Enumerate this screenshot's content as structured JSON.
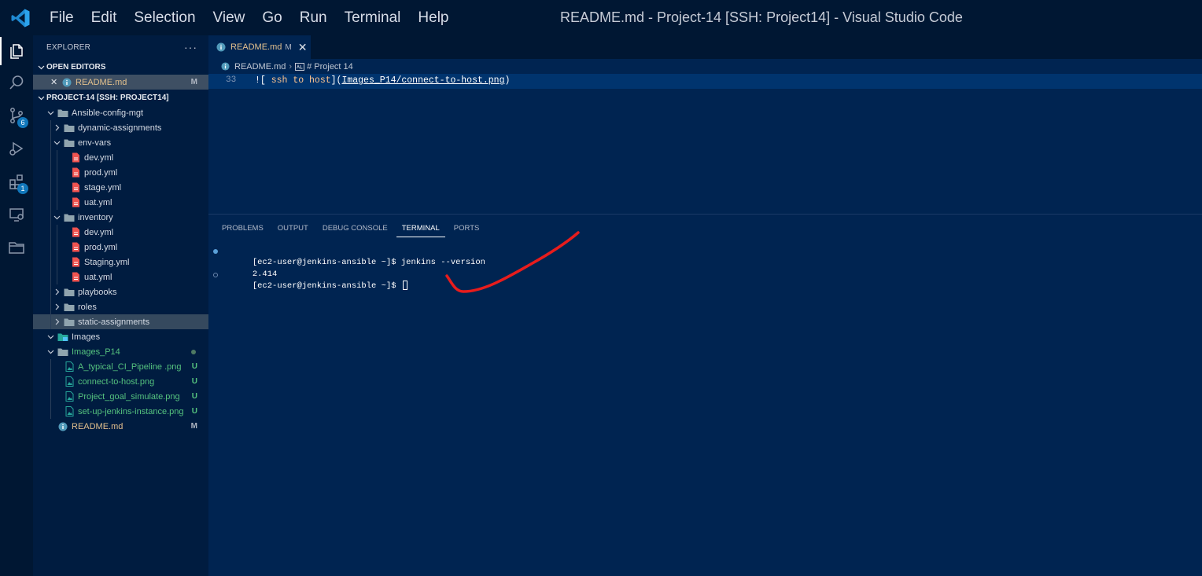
{
  "titlebar": {
    "menu": [
      "File",
      "Edit",
      "Selection",
      "View",
      "Go",
      "Run",
      "Terminal",
      "Help"
    ],
    "window_title": "README.md - Project-14 [SSH: Project14] - Visual Studio Code"
  },
  "activitybar": {
    "items": [
      {
        "icon": "explorer-icon",
        "active": true
      },
      {
        "icon": "search-icon"
      },
      {
        "icon": "source-control-icon",
        "badge": "6"
      },
      {
        "icon": "run-debug-icon"
      },
      {
        "icon": "extensions-icon",
        "badge": "1"
      },
      {
        "icon": "remote-explorer-icon"
      },
      {
        "icon": "folder-icon"
      }
    ]
  },
  "sidebar": {
    "title": "EXPLORER",
    "more": "···",
    "open_editors": {
      "header": "OPEN EDITORS",
      "file": "README.md",
      "status": "M"
    },
    "project": {
      "header": "PROJECT-14 [SSH: PROJECT14]",
      "tree": [
        {
          "label": "Ansible-config-mgt",
          "type": "folder",
          "open": true,
          "depth": 0
        },
        {
          "label": "dynamic-assignments",
          "type": "folder",
          "open": false,
          "depth": 1
        },
        {
          "label": "env-vars",
          "type": "folder",
          "open": true,
          "depth": 1
        },
        {
          "label": "dev.yml",
          "type": "yml",
          "depth": 2
        },
        {
          "label": "prod.yml",
          "type": "yml",
          "depth": 2
        },
        {
          "label": "stage.yml",
          "type": "yml",
          "depth": 2
        },
        {
          "label": "uat.yml",
          "type": "yml",
          "depth": 2
        },
        {
          "label": "inventory",
          "type": "folder",
          "open": true,
          "depth": 1
        },
        {
          "label": "dev.yml",
          "type": "yml",
          "depth": 2
        },
        {
          "label": "prod.yml",
          "type": "yml",
          "depth": 2
        },
        {
          "label": "Staging.yml",
          "type": "yml",
          "depth": 2
        },
        {
          "label": "uat.yml",
          "type": "yml",
          "depth": 2
        },
        {
          "label": "playbooks",
          "type": "folder",
          "open": false,
          "depth": 1
        },
        {
          "label": "roles",
          "type": "folder",
          "open": false,
          "depth": 1
        },
        {
          "label": "static-assignments",
          "type": "folder",
          "open": false,
          "depth": 1,
          "selected": true
        },
        {
          "label": "Images",
          "type": "image-folder",
          "open": true,
          "depth": 0
        },
        {
          "label": "Images_P14",
          "type": "folder",
          "open": true,
          "depth": 0,
          "status": "dot",
          "untracked": true
        },
        {
          "label": "A_typical_CI_Pipeline .png",
          "type": "png",
          "depth": 1,
          "status": "U",
          "untracked": true
        },
        {
          "label": "connect-to-host.png",
          "type": "png",
          "depth": 1,
          "status": "U",
          "untracked": true
        },
        {
          "label": "Project_goal_simulate.png",
          "type": "png",
          "depth": 1,
          "status": "U",
          "untracked": true
        },
        {
          "label": "set-up-jenkins-instance.png",
          "type": "png",
          "depth": 1,
          "status": "U",
          "untracked": true
        },
        {
          "label": "README.md",
          "type": "md",
          "depth": 0,
          "status": "M",
          "modified": true
        }
      ]
    }
  },
  "editor": {
    "tab": {
      "label": "README.md",
      "status": "M",
      "close": "✕"
    },
    "breadcrumbs": {
      "file": "README.md",
      "symbol": "# Project 14"
    },
    "line_number": "33",
    "code": {
      "prefix": "![",
      "alt": " ssh to host",
      "mid": "](",
      "url": "Images_P14/connect-to-host.png",
      "suffix": ")"
    }
  },
  "panel": {
    "tabs": [
      "PROBLEMS",
      "OUTPUT",
      "DEBUG CONSOLE",
      "TERMINAL",
      "PORTS"
    ],
    "active_tab": "TERMINAL",
    "terminal": {
      "line1": "[ec2-user@jenkins-ansible ~]$ jenkins --version",
      "line2": "2.414",
      "line3": "[ec2-user@jenkins-ansible ~]$ "
    }
  },
  "colors": {
    "background": "#002451",
    "activitybar": "#001733",
    "sidebar": "#001c40",
    "annotation": "#e81c1c",
    "untracked": "#55c37f",
    "modified": "#e2c08d"
  }
}
